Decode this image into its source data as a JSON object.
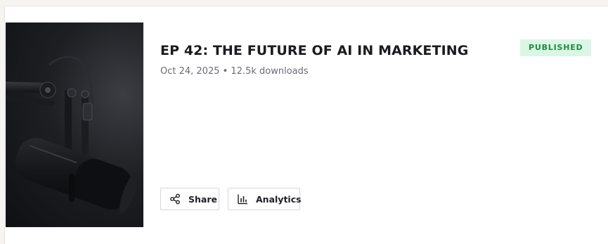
{
  "episode": {
    "title": "EP 42: THE FUTURE OF AI IN MARKETING",
    "meta": "Oct 24, 2025 • 12.5k downloads",
    "status_badge": "PUBLISHED",
    "thumbnail_icon": "podcast-microphone-image"
  },
  "actions": {
    "share_label": "Share",
    "share_icon": "share-icon",
    "analytics_label": "Analytics",
    "analytics_icon": "bar-chart-icon"
  },
  "colors": {
    "badge_bg": "#dbf6e4",
    "badge_text": "#1d8a45",
    "title_text": "#1b1b1f",
    "meta_text": "#6b6b75",
    "button_border": "#d6d6db"
  }
}
